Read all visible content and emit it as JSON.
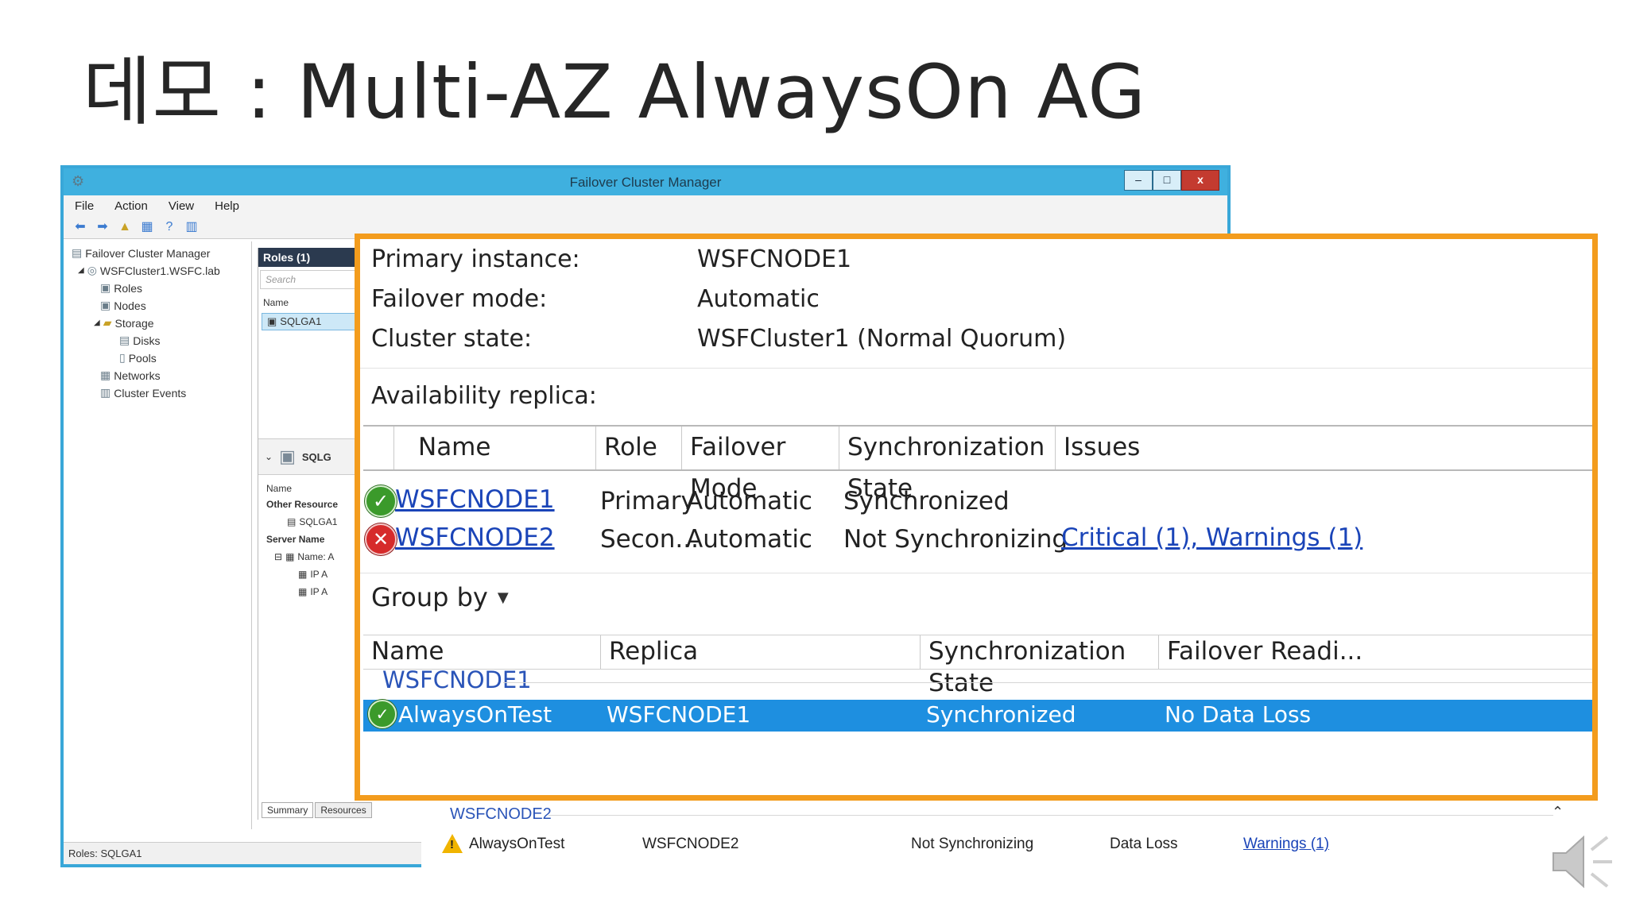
{
  "slide": {
    "title": "데모 : Multi-AZ AlwaysOn AG"
  },
  "window": {
    "title": "Failover Cluster Manager",
    "controls": {
      "minimize": "–",
      "maximize": "□",
      "close": "x"
    },
    "menu": [
      "File",
      "Action",
      "View",
      "Help"
    ],
    "tree": [
      {
        "label": "Failover Cluster Manager",
        "icon": "cluster-manager-icon"
      },
      {
        "label": "WSFCluster1.WSFC.lab",
        "icon": "cluster-icon"
      },
      {
        "label": "Roles",
        "icon": "roles-icon"
      },
      {
        "label": "Nodes",
        "icon": "nodes-icon"
      },
      {
        "label": "Storage",
        "icon": "storage-icon"
      },
      {
        "label": "Disks",
        "icon": "disk-icon"
      },
      {
        "label": "Pools",
        "icon": "pool-icon"
      },
      {
        "label": "Networks",
        "icon": "network-icon"
      },
      {
        "label": "Cluster Events",
        "icon": "events-icon"
      }
    ],
    "roles_pane": {
      "header": "Roles (1)",
      "search_placeholder": "Search",
      "name_col": "Name",
      "item": "SQLGA1",
      "detail_title": "SQLG",
      "detail_name_col": "Name",
      "other_resources": "Other Resource",
      "resource_item": "SQLGA1",
      "server_name": "Server Name",
      "name_item": "Name: A",
      "ip1": "IP A",
      "ip2": "IP A",
      "tabs": [
        "Summary",
        "Resources"
      ]
    },
    "status": "Roles: SQLGA1"
  },
  "zoom": {
    "properties": [
      {
        "label": "Primary instance:",
        "value": "WSFCNODE1"
      },
      {
        "label": "Failover mode:",
        "value": "Automatic"
      },
      {
        "label": "Cluster state:",
        "value": "WSFCluster1 (Normal Quorum)"
      }
    ],
    "availability_label": "Availability replica:",
    "replica_columns": [
      "Name",
      "Role",
      "Failover Mode",
      "Synchronization State",
      "Issues"
    ],
    "replicas": [
      {
        "status": "ok",
        "name": "WSFCNODE1",
        "role": "Primary",
        "failover": "Automatic",
        "sync": "Synchronized",
        "issues": ""
      },
      {
        "status": "error",
        "name": "WSFCNODE2",
        "role": "Secon...",
        "failover": "Automatic",
        "sync": "Not Synchronizing",
        "issues": "Critical (1), Warnings (1)"
      }
    ],
    "group_by": "Group by",
    "db_columns": [
      "Name",
      "Replica",
      "Synchronization State",
      "Failover Readi..."
    ],
    "group1": "WSFCNODE1",
    "db_row1": {
      "name": "AlwaysOnTest",
      "replica": "WSFCNODE1",
      "sync": "Synchronized",
      "readiness": "No Data Loss"
    }
  },
  "below": {
    "group2": "WSFCNODE2",
    "db_row2": {
      "name": "AlwaysOnTest",
      "replica": "WSFCNODE2",
      "sync": "Not Synchronizing",
      "readiness": "Data Loss",
      "issues": "Warnings (1)"
    }
  }
}
